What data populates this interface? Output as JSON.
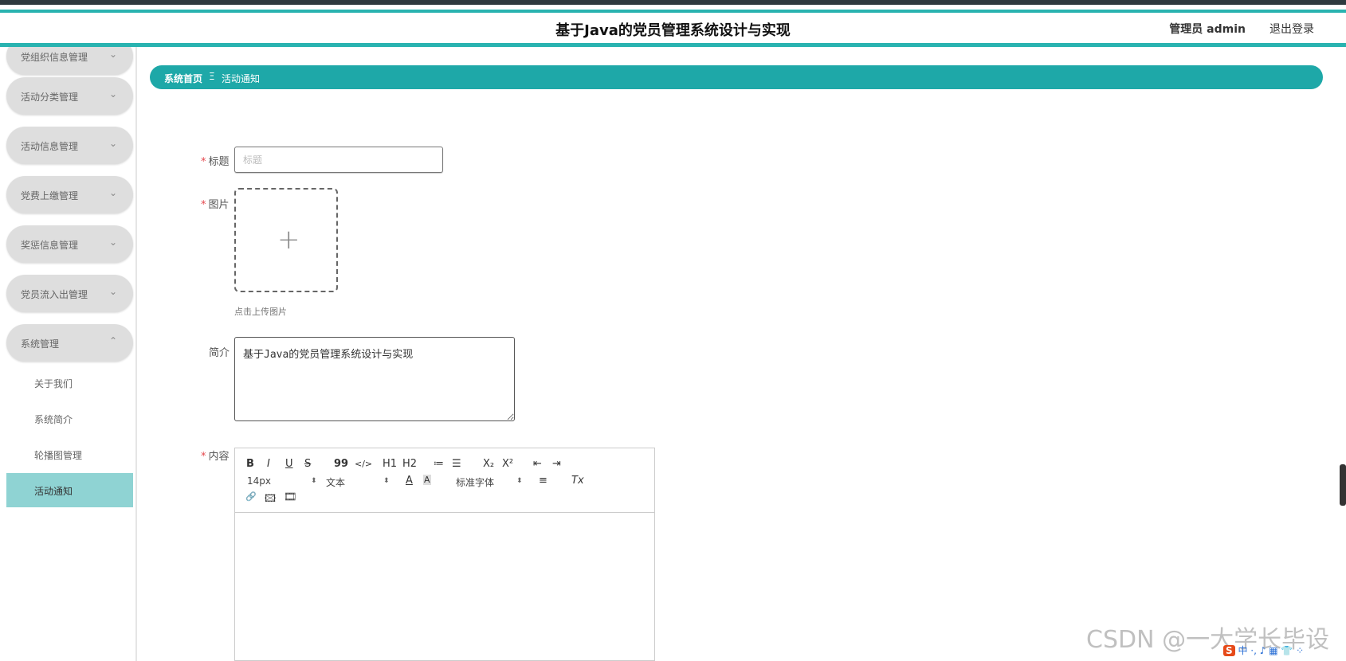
{
  "header": {
    "title": "基于Java的党员管理系统设计与实现",
    "user_label": "管理员 admin",
    "logout_label": "退出登录"
  },
  "sidebar": {
    "menus": [
      {
        "label": "党组织信息管理"
      },
      {
        "label": "活动分类管理"
      },
      {
        "label": "活动信息管理"
      },
      {
        "label": "党费上缴管理"
      },
      {
        "label": "奖惩信息管理"
      },
      {
        "label": "党员流入出管理"
      },
      {
        "label": "系统管理"
      }
    ],
    "submenu": [
      {
        "label": "关于我们"
      },
      {
        "label": "系统简介"
      },
      {
        "label": "轮播图管理"
      },
      {
        "label": "活动通知"
      }
    ]
  },
  "breadcrumb": {
    "home": "系统首页",
    "sep": "Ξ",
    "current": "活动通知"
  },
  "form": {
    "title_label": "标题",
    "title_placeholder": "标题",
    "title_value": "",
    "image_label": "图片",
    "upload_hint": "点击上传图片",
    "intro_label": "简介",
    "intro_value": "基于Java的党员管理系统设计与实现",
    "content_label": "内容",
    "required_mark": "*"
  },
  "editor": {
    "bold": "B",
    "italic": "I",
    "underline": "U",
    "strike": "S",
    "quote": "99",
    "code": "</>",
    "h1": "H1",
    "h2": "H2",
    "ol": "≔",
    "ul": "☰",
    "sub": "X₂",
    "sup": "X²",
    "outdent": "⇤",
    "indent": "⇥",
    "size_value": "14px",
    "text_value": "文本",
    "font_color": "A",
    "bg_color": "A",
    "font_value": "标准字体",
    "align": "≡",
    "clear": "Tx",
    "link": "🔗",
    "image": "🖾",
    "video": "🎞"
  },
  "watermark": "CSDN @一大学长毕设",
  "ime": {
    "logo": "S",
    "text": "中 ·, ♪ ▦ 👕 ⁘"
  }
}
